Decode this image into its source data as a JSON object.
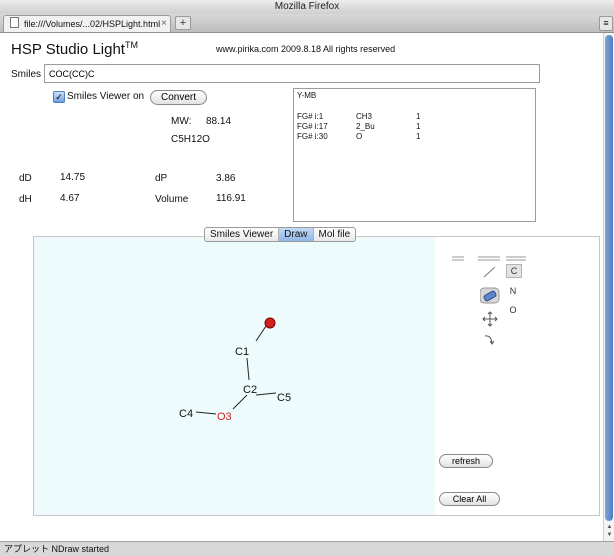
{
  "window": {
    "title": "Mozilla Firefox",
    "tab_label": "file:///Volumes/...02/HSPLight.html"
  },
  "icons": [
    "document-icon",
    "close-icon",
    "plus-icon",
    "tab-list-icon",
    "checkbox-icon",
    "line-tool-icon",
    "eraser-icon",
    "move-icon",
    "rotate-icon"
  ],
  "colors": {
    "canvas_bg": "#eefbfd",
    "oxygen": "#d32020",
    "selected_tab": "#a9c8ef"
  },
  "app": {
    "title": "HSP Studio Light",
    "trademark": "TM",
    "copyright": "www.pirika.com  2009.8.18  All rights reserved",
    "smiles_label": "Smiles",
    "smiles_value": "COC(CC)C",
    "viewer_checkbox": "✓",
    "viewer_label": "Smiles Viewer on",
    "convert_button": "Convert",
    "mw_label": "MW:",
    "mw_value": "88.14",
    "formula": "C5H12O",
    "dD_label": "dD",
    "dD_value": "14.75",
    "dP_label": "dP",
    "dP_value": "3.86",
    "dH_label": "dH",
    "dH_value": "4.67",
    "volume_label": "Volume",
    "volume_value": "116.91"
  },
  "results": {
    "title": "Y-MB",
    "rows": [
      {
        "fg": "FG# i:1",
        "group": "CH3",
        "count": "1"
      },
      {
        "fg": "FG# i:17",
        "group": "2_Bu",
        "count": "1"
      },
      {
        "fg": "FG# i:30",
        "group": "O",
        "count": "1"
      }
    ]
  },
  "editor_tabs": [
    "Smiles Viewer",
    "Draw",
    "Mol file"
  ],
  "editor_active_tab": "Draw",
  "atoms": {
    "c1": "C1",
    "c2": "C2",
    "c4": "C4",
    "c5": "C5",
    "o3": "O3"
  },
  "element_buttons": [
    "C",
    "N",
    "O"
  ],
  "refresh_button": "refresh",
  "clear_button": "Clear All",
  "status": "アプレット NDraw started"
}
